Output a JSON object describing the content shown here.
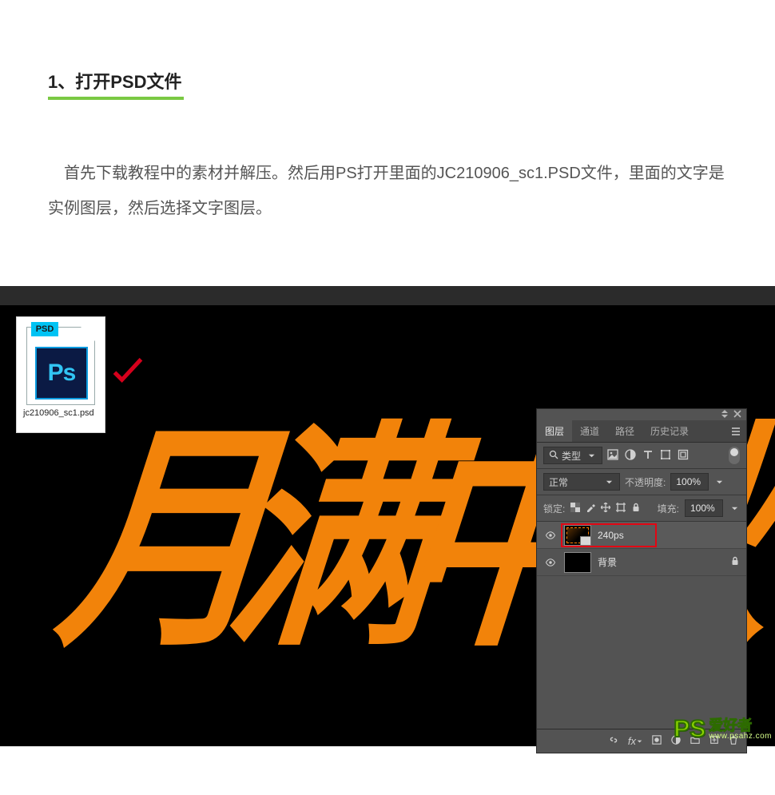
{
  "article": {
    "heading": "1、打开PSD文件",
    "paragraph": "首先下载教程中的素材并解压。然后用PS打开里面的JC210906_sc1.PSD文件，里面的文字是实例图层，然后选择文字图层。",
    "psd_filename": "jc210906_sc1.psd",
    "psd_badge": "PSD",
    "psd_core": "Ps",
    "calligraphy": "月满中秋"
  },
  "panel": {
    "tabs": [
      "图层",
      "通道",
      "路径",
      "历史记录"
    ],
    "active_tab_index": 0,
    "filter": {
      "mode_label": "类型",
      "search_icon": "search-icon"
    },
    "blend": {
      "mode": "正常",
      "opacity_label": "不透明度:",
      "opacity_value": "100%"
    },
    "lock": {
      "label": "锁定:",
      "fill_label": "填充:",
      "fill_value": "100%"
    },
    "layers": [
      {
        "name": "240ps",
        "type": "smart",
        "visible": true,
        "selected": true
      },
      {
        "name": "背景",
        "type": "bg",
        "visible": true,
        "locked": true
      }
    ]
  },
  "watermark": {
    "logo": "PS",
    "zh": "爱好者",
    "url": "www.psahz.com"
  }
}
